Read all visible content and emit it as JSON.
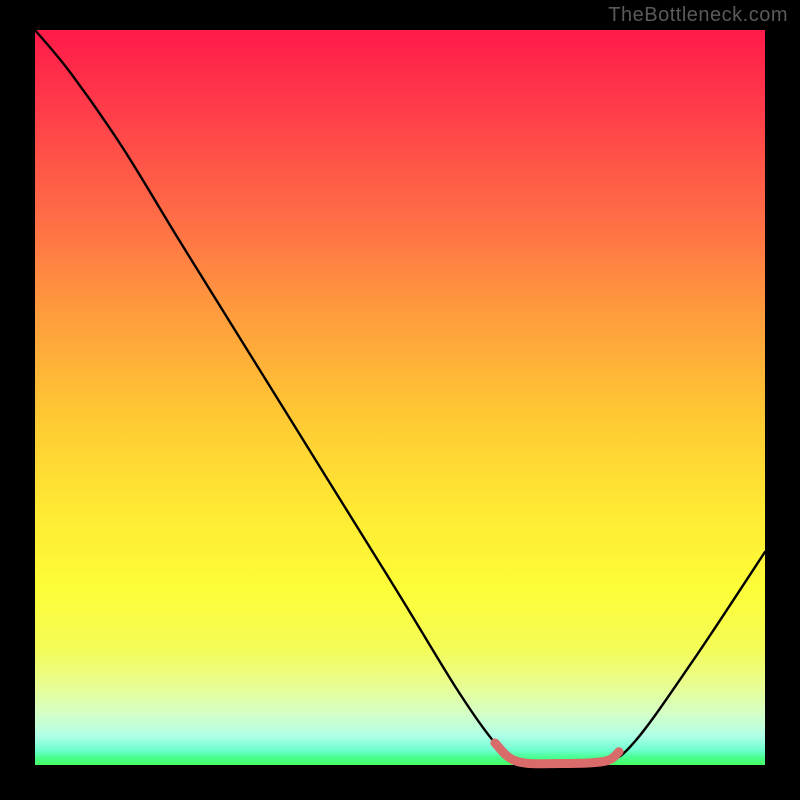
{
  "watermark": "TheBottleneck.com",
  "chart_data": {
    "type": "line",
    "title": "",
    "xlabel": "",
    "ylabel": "",
    "xlim": [
      0,
      100
    ],
    "ylim": [
      0,
      100
    ],
    "series": [
      {
        "name": "curve",
        "points": [
          {
            "x": 0,
            "y": 100
          },
          {
            "x": 5,
            "y": 94
          },
          {
            "x": 12,
            "y": 84
          },
          {
            "x": 20,
            "y": 71
          },
          {
            "x": 30,
            "y": 55
          },
          {
            "x": 40,
            "y": 39
          },
          {
            "x": 50,
            "y": 23
          },
          {
            "x": 58,
            "y": 10
          },
          {
            "x": 63,
            "y": 3
          },
          {
            "x": 66,
            "y": 0.5
          },
          {
            "x": 72,
            "y": 0.2
          },
          {
            "x": 78,
            "y": 0.5
          },
          {
            "x": 82,
            "y": 3
          },
          {
            "x": 90,
            "y": 14
          },
          {
            "x": 100,
            "y": 29
          }
        ]
      },
      {
        "name": "highlight",
        "color": "#d96b6b",
        "points": [
          {
            "x": 63,
            "y": 3
          },
          {
            "x": 66,
            "y": 0.5
          },
          {
            "x": 72,
            "y": 0.2
          },
          {
            "x": 78,
            "y": 0.5
          },
          {
            "x": 80,
            "y": 1.8
          }
        ]
      }
    ]
  }
}
